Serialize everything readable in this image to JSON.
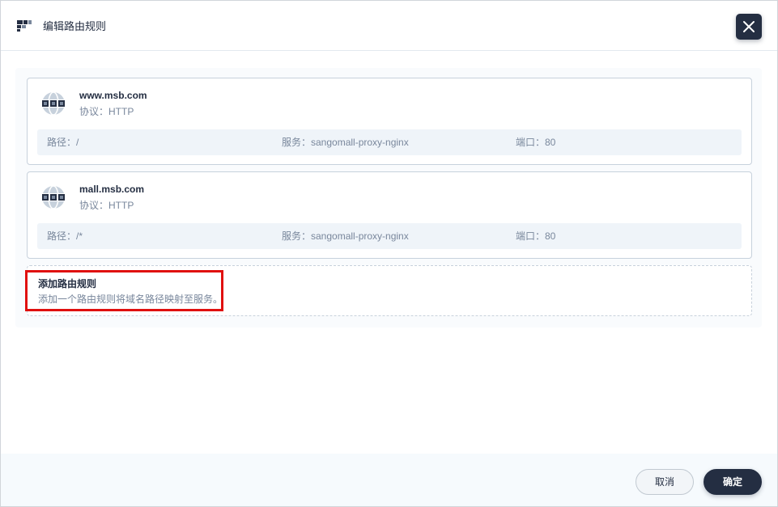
{
  "header": {
    "title": "编辑路由规则",
    "icon": "route-icon",
    "close_icon": "close-icon"
  },
  "rules": [
    {
      "host": "www.msb.com",
      "protocol": "协议：HTTP",
      "path": "路径：/",
      "service": "服务：sangomall-proxy-nginx",
      "port": "端口：80",
      "icon": "globe-icon"
    },
    {
      "host": "mall.msb.com",
      "protocol": "协议：HTTP",
      "path": "路径：/*",
      "service": "服务：sangomall-proxy-nginx",
      "port": "端口：80",
      "icon": "globe-icon"
    }
  ],
  "add_rule": {
    "title": "添加路由规则",
    "description": "添加一个路由规则将域名路径映射至服务。"
  },
  "footer": {
    "cancel_label": "取消",
    "ok_label": "确定"
  },
  "colors": {
    "primary_dark": "#242e42",
    "muted_text": "#79879c",
    "highlight": "#e0100f",
    "row_bg": "#eff4f9"
  }
}
